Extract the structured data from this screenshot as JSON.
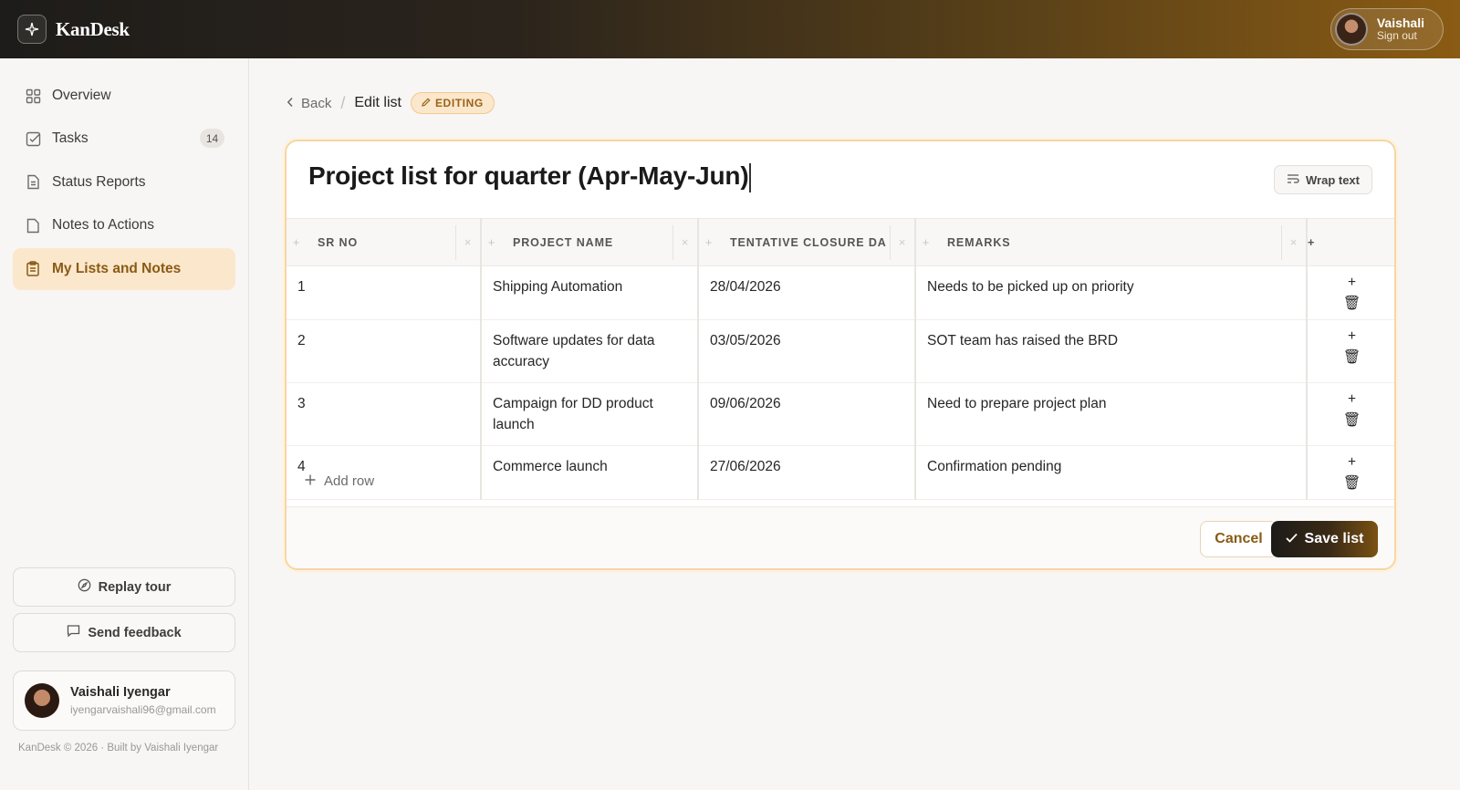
{
  "app": {
    "name": "KanDesk"
  },
  "user": {
    "short_name": "Vaishali",
    "sign_out": "Sign out",
    "full_name": "Vaishali Iyengar",
    "email": "iyengarvaishali96@gmail.com"
  },
  "sidebar": {
    "items": [
      {
        "label": "Overview",
        "icon": "grid-icon"
      },
      {
        "label": "Tasks",
        "icon": "checkbox-icon",
        "badge": "14"
      },
      {
        "label": "Status Reports",
        "icon": "document-icon"
      },
      {
        "label": "Notes to Actions",
        "icon": "note-icon"
      },
      {
        "label": "My Lists and Notes",
        "icon": "clipboard-icon",
        "active": true
      }
    ],
    "replay_tour": "Replay tour",
    "send_feedback": "Send feedback",
    "footer": "KanDesk © 2026 · Built by Vaishali Iyengar"
  },
  "breadcrumb": {
    "back": "Back",
    "current": "Edit list",
    "status_badge": "EDITING"
  },
  "list": {
    "title": "Project list for quarter (Apr-May-Jun)",
    "wrap_text": "Wrap text",
    "columns": [
      "SR NO",
      "PROJECT NAME",
      "TENTATIVE CLOSURE DA",
      "REMARKS"
    ],
    "rows": [
      [
        "1",
        "Shipping Automation",
        "28/04/2026",
        "Needs to be picked up on priority"
      ],
      [
        "2",
        "Software updates for data accuracy",
        "03/05/2026",
        "SOT team has raised the BRD"
      ],
      [
        "3",
        "Campaign for DD product launch",
        "09/06/2026",
        "Need to prepare project plan"
      ],
      [
        "4",
        "Commerce launch",
        "27/06/2026",
        "Confirmation pending"
      ]
    ],
    "add_row": "Add row",
    "cancel": "Cancel",
    "save": "Save list"
  },
  "colors": {
    "accent": "#8a5a14",
    "accent_light": "#fbe7cc",
    "header_dark": "#1e1c1a"
  }
}
